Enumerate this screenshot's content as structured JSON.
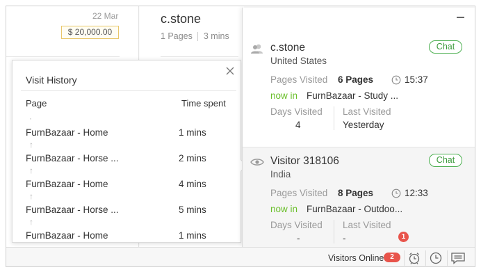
{
  "background": {
    "date": "22 Mar",
    "amount": "$ 20,000.00",
    "contact_name": "c.stone",
    "pages_meta": "1 Pages",
    "time_meta": "3 mins"
  },
  "history": {
    "title": "Visit History",
    "col_page": "Page",
    "col_time": "Time spent",
    "rows": [
      {
        "page": "FurnBazaar - Home",
        "time": "1 mins"
      },
      {
        "page": "FurnBazaar - Horse ...",
        "time": "2 mins"
      },
      {
        "page": "FurnBazaar - Home",
        "time": "4 mins"
      },
      {
        "page": "FurnBazaar - Horse ...",
        "time": "5 mins"
      },
      {
        "page": "FurnBazaar - Home",
        "time": "1 mins"
      }
    ],
    "arrow_glyph": "↑",
    "dot_glyph": "·"
  },
  "visitors": [
    {
      "name": "c.stone",
      "country": "United States",
      "chat_label": "Chat",
      "pages_visited_label": "Pages Visited",
      "pages_visited": "6 Pages",
      "time": "15:37",
      "now_in_label": "now in",
      "now_in_page": "FurnBazaar - Study ...",
      "days_visited_label": "Days Visited",
      "days_visited": "4",
      "last_visited_label": "Last Visited",
      "last_visited": "Yesterday",
      "icon": "user-icon"
    },
    {
      "name": "Visitor 318106",
      "country": "India",
      "chat_label": "Chat",
      "pages_visited_label": "Pages Visited",
      "pages_visited": "8 Pages",
      "time": "12:33",
      "now_in_label": "now in",
      "now_in_page": "FurnBazaar - Outdoo...",
      "days_visited_label": "Days Visited",
      "days_visited": "-",
      "last_visited_label": "Last Visited",
      "last_visited": "-",
      "icon": "eye-icon"
    }
  ],
  "bottombar": {
    "visitors_online_label": "Visitors Online",
    "visitors_online_count": "2",
    "notification_count": "1"
  },
  "colors": {
    "accent_green": "#4caf50",
    "now_in_green": "#6abf2a",
    "badge_red": "#e8544b"
  }
}
